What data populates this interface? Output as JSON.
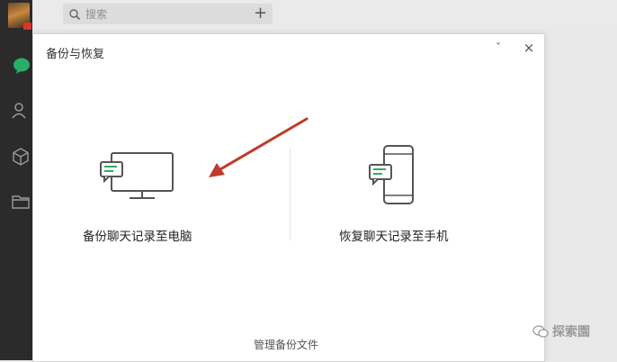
{
  "search": {
    "placeholder": "搜索",
    "add_label": "+"
  },
  "dialog": {
    "title": "备份与恢复",
    "minimize_label": "ˇ",
    "close_label": "×",
    "option_backup_label": "备份聊天记录至电脑",
    "option_restore_label": "恢复聊天记录至手机",
    "manage_label": "管理备份文件"
  },
  "watermark": {
    "text": "探索園"
  },
  "colors": {
    "accent_green": "#2aae67",
    "arrow_red": "#c0392b",
    "sidebar_bg": "#2b2b2b"
  },
  "icons": [
    "chat-icon",
    "contacts-icon",
    "favorites-icon",
    "folder-icon",
    "search-icon",
    "computer-icon",
    "phone-icon"
  ]
}
